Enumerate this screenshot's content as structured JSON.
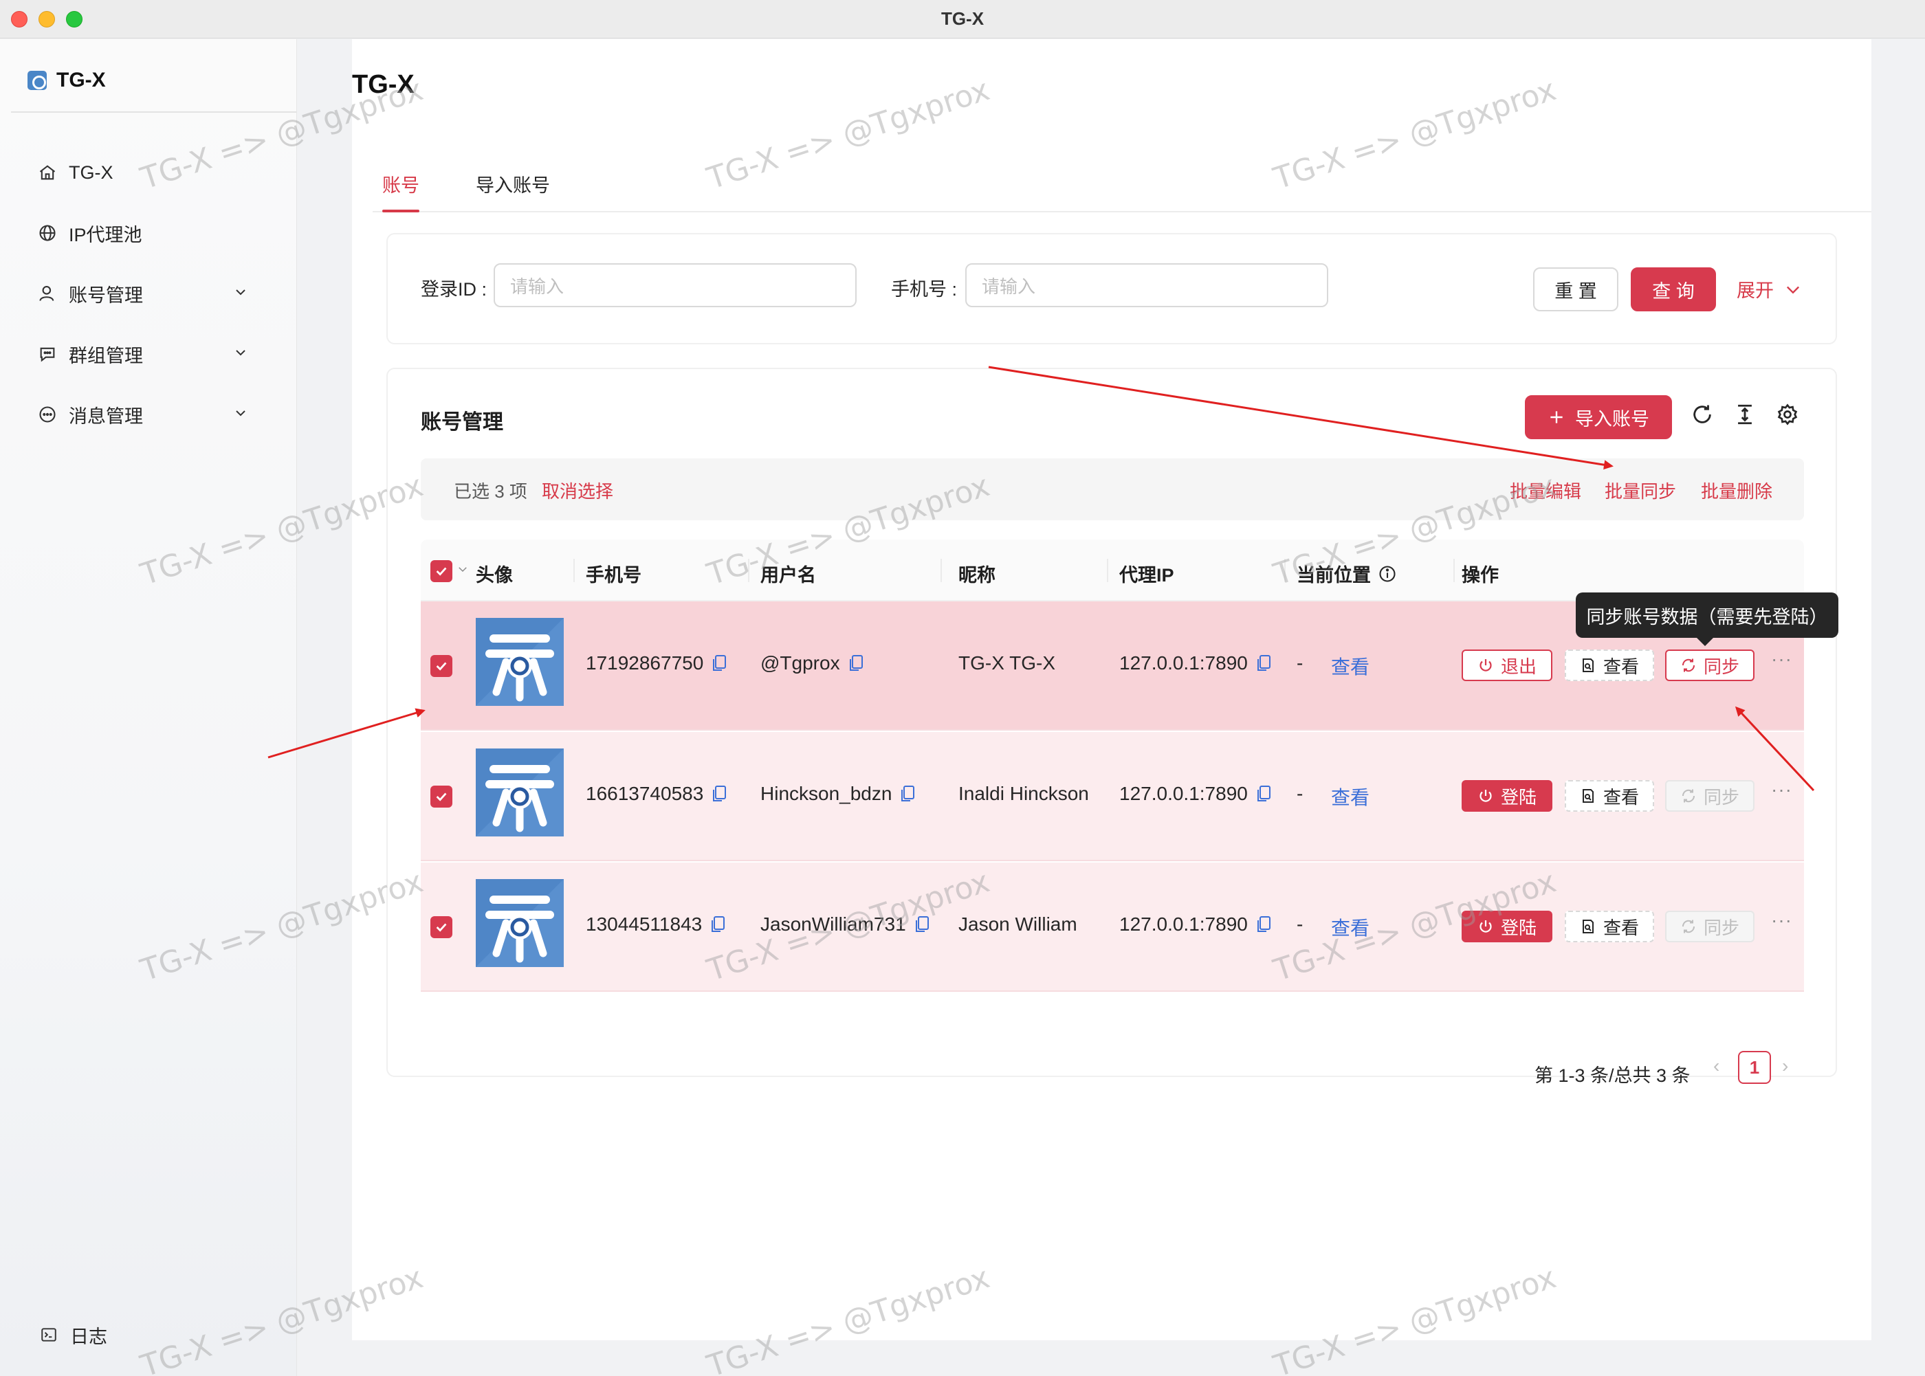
{
  "window": {
    "title": "TG-X"
  },
  "sidebar": {
    "brand": "TG-X",
    "items": [
      {
        "label": "TG-X",
        "icon": "home-icon"
      },
      {
        "label": "IP代理池",
        "icon": "globe-icon"
      },
      {
        "label": "账号管理",
        "icon": "user-icon",
        "expandable": true
      },
      {
        "label": "群组管理",
        "icon": "chat-icon",
        "expandable": true
      },
      {
        "label": "消息管理",
        "icon": "message-icon",
        "expandable": true
      }
    ],
    "footer_label": "日志"
  },
  "page": {
    "title": "TG-X",
    "tabs": [
      {
        "label": "账号",
        "active": true
      },
      {
        "label": "导入账号",
        "active": false
      }
    ]
  },
  "search": {
    "login_id_label": "登录ID :",
    "login_id_placeholder": "请输入",
    "phone_label": "手机号 :",
    "phone_placeholder": "请输入",
    "reset_label": "重 置",
    "query_label": "查 询",
    "expand_label": "展开"
  },
  "table": {
    "title": "账号管理",
    "import_button": "导入账号",
    "selection": {
      "text": "已选 3 项",
      "cancel": "取消选择",
      "batch_edit": "批量编辑",
      "batch_sync": "批量同步",
      "batch_delete": "批量删除"
    },
    "columns": [
      "头像",
      "手机号",
      "用户名",
      "昵称",
      "代理IP",
      "当前位置",
      "操作"
    ],
    "rows": [
      {
        "phone": "17192867750",
        "username": "@Tgprox",
        "nickname": "TG-X TG-X",
        "proxy": "127.0.0.1:7890",
        "location": "-",
        "view_link": "查看",
        "status_button": "退出",
        "view_button": "查看",
        "sync_button": "同步",
        "sync_enabled": true,
        "logged_in": true
      },
      {
        "phone": "16613740583",
        "username": "Hinckson_bdzn",
        "nickname": "Inaldi Hinckson",
        "proxy": "127.0.0.1:7890",
        "location": "-",
        "view_link": "查看",
        "status_button": "登陆",
        "view_button": "查看",
        "sync_button": "同步",
        "sync_enabled": false,
        "logged_in": false
      },
      {
        "phone": "13044511843",
        "username": "JasonWilliam731",
        "nickname": "Jason William",
        "proxy": "127.0.0.1:7890",
        "location": "-",
        "view_link": "查看",
        "status_button": "登陆",
        "view_button": "查看",
        "sync_button": "同步",
        "sync_enabled": false,
        "logged_in": false
      }
    ],
    "tooltip": "同步账号数据（需要先登陆）",
    "pagination": {
      "summary": "第 1-3 条/总共 3 条",
      "current": "1"
    }
  },
  "watermark": "TG-X => @Tgxprox",
  "colors": {
    "accent": "#d73a4e",
    "link": "#3b6fd8",
    "row_selected": "#fcecee",
    "row_hover": "#f8d3d8"
  }
}
